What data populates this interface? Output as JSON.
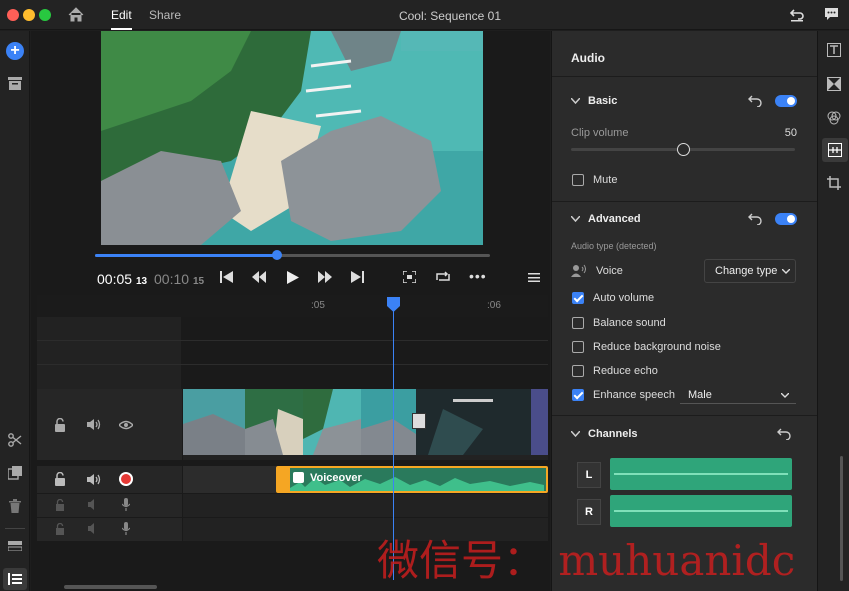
{
  "window": {
    "title": "Cool: Sequence 01"
  },
  "nav": {
    "edit": "Edit",
    "share": "Share"
  },
  "player": {
    "current_time": "00:05",
    "current_frames": "13",
    "total_time": "00:10",
    "total_frames": "15",
    "progress": 0.46
  },
  "ruler": {
    "mark1": ":05",
    "mark2": ":06"
  },
  "timeline": {
    "clip_label": "Voiceover"
  },
  "audio": {
    "title": "Audio",
    "basic": {
      "label": "Basic",
      "clip_volume_label": "Clip volume",
      "clip_volume_value": "50",
      "volume_fraction": 0.5,
      "mute_label": "Mute"
    },
    "advanced": {
      "label": "Advanced",
      "audio_type_label": "Audio type (detected)",
      "voice_label": "Voice",
      "change_type": "Change type",
      "auto_volume": "Auto volume",
      "balance_sound": "Balance sound",
      "reduce_noise": "Reduce background noise",
      "reduce_echo": "Reduce echo",
      "enhance_speech": "Enhance speech",
      "enhance_option": "Male"
    },
    "channels": {
      "label": "Channels",
      "left": "L",
      "right": "R"
    }
  },
  "watermark": "微信号： muhuanidc",
  "colors": {
    "accent": "#3b82f6",
    "clip_orange": "#f5a623",
    "wave_green": "#2fa57a",
    "record_red": "#e53935"
  }
}
